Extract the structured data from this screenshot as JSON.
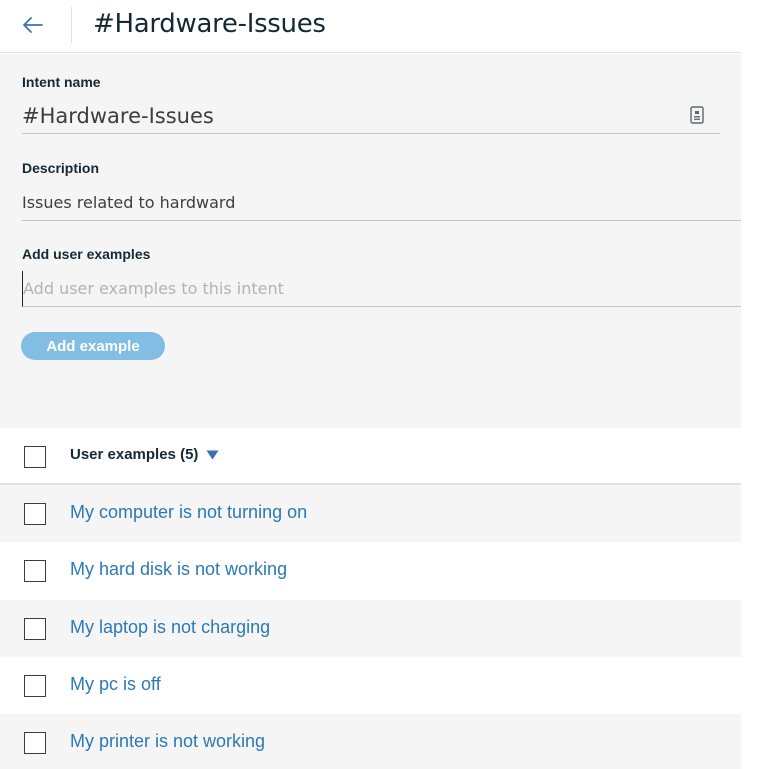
{
  "header": {
    "title": "#Hardware-Issues",
    "back_icon": "arrow-left-icon"
  },
  "form": {
    "intent_label": "Intent name",
    "intent_value": "#Hardware-Issues",
    "copy_icon": "copy-icon",
    "description_label": "Description",
    "description_value": "Issues related to hardward",
    "examples_label": "Add user examples",
    "examples_placeholder": "Add user examples to this intent",
    "add_button": "Add example"
  },
  "examples": {
    "header_label": "User examples (5)",
    "sort_icon": "caret-down-icon",
    "items": [
      "My computer is not turning on",
      "My hard disk is not working",
      "My laptop is not charging",
      "My pc is off",
      "My printer is not working"
    ]
  },
  "colors": {
    "accent": "#2b79b6",
    "button_disabled": "#82bde3",
    "panel_bg": "#f5f5f5"
  }
}
